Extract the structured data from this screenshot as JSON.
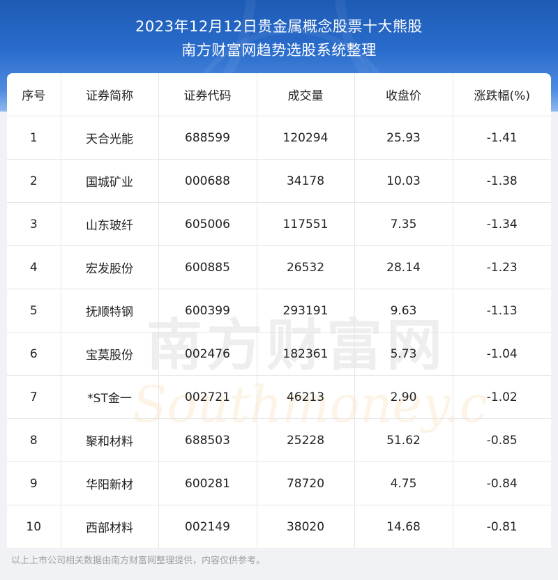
{
  "title": {
    "line1": "2023年12月12日贵金属概念股票十大熊股",
    "line2": "南方财富网趋势选股系统整理"
  },
  "table": {
    "headers": [
      "序号",
      "证券简称",
      "证券代码",
      "成交量",
      "收盘价",
      "涨跌幅(%)"
    ],
    "rows": [
      [
        "1",
        "天合光能",
        "688599",
        "120294",
        "25.93",
        "-1.41"
      ],
      [
        "2",
        "国城矿业",
        "000688",
        "34178",
        "10.03",
        "-1.38"
      ],
      [
        "3",
        "山东玻纤",
        "605006",
        "117551",
        "7.35",
        "-1.34"
      ],
      [
        "4",
        "宏发股份",
        "600885",
        "26532",
        "28.14",
        "-1.23"
      ],
      [
        "5",
        "抚顺特钢",
        "600399",
        "293191",
        "9.63",
        "-1.13"
      ],
      [
        "6",
        "宝莫股份",
        "002476",
        "182361",
        "5.73",
        "-1.04"
      ],
      [
        "7",
        "*ST金一",
        "002721",
        "46213",
        "2.90",
        "-1.02"
      ],
      [
        "8",
        "聚和材料",
        "688503",
        "25228",
        "51.62",
        "-0.85"
      ],
      [
        "9",
        "华阳新材",
        "600281",
        "78720",
        "4.75",
        "-0.84"
      ],
      [
        "10",
        "西部材料",
        "002149",
        "38020",
        "14.68",
        "-0.81"
      ]
    ]
  },
  "watermark": {
    "cn": "南方财富网",
    "en": "Southmoney.com"
  },
  "footer": "以上上市公司相关数据由南方财富网整理提供，内容仅供参考。",
  "colors": {
    "header_blue": "#2a6ccc",
    "grid_line": "#e6e6e6",
    "footer_text": "#a0a0a0"
  }
}
